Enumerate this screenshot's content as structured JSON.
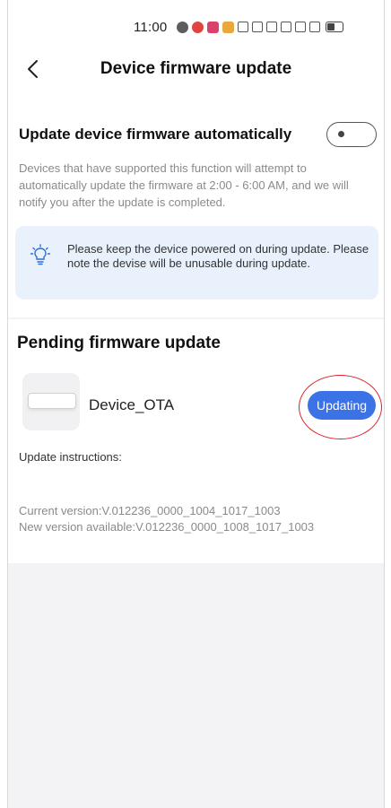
{
  "status_bar": {
    "time": "11:00"
  },
  "header": {
    "title": "Device firmware update",
    "back_icon": "chevron-left-icon"
  },
  "auto_update": {
    "title": "Update device firmware automatically",
    "enabled": false,
    "description": "Devices that have supported this function will attempt to automatically update the firmware at 2:00 - 6:00 AM, and we will notify you after the update is completed."
  },
  "notice": {
    "icon": "lightbulb-icon",
    "text": "Please keep the device powered on during update. Please note the devise will be unusable during update."
  },
  "pending": {
    "title": "Pending firmware update",
    "device": {
      "name": "Device_OTA",
      "status_button": "Updating"
    },
    "instructions_label": "Update instructions:",
    "current_version": "Current version:V.012236_0000_1004_1017_1003",
    "new_version": "New version available:V.012236_0000_1008_1017_1003"
  },
  "colors": {
    "accent": "#3b72e6",
    "notice_bg": "#e9f1fd",
    "page_bg": "#f3f3f5",
    "highlight": "#d6272c"
  }
}
